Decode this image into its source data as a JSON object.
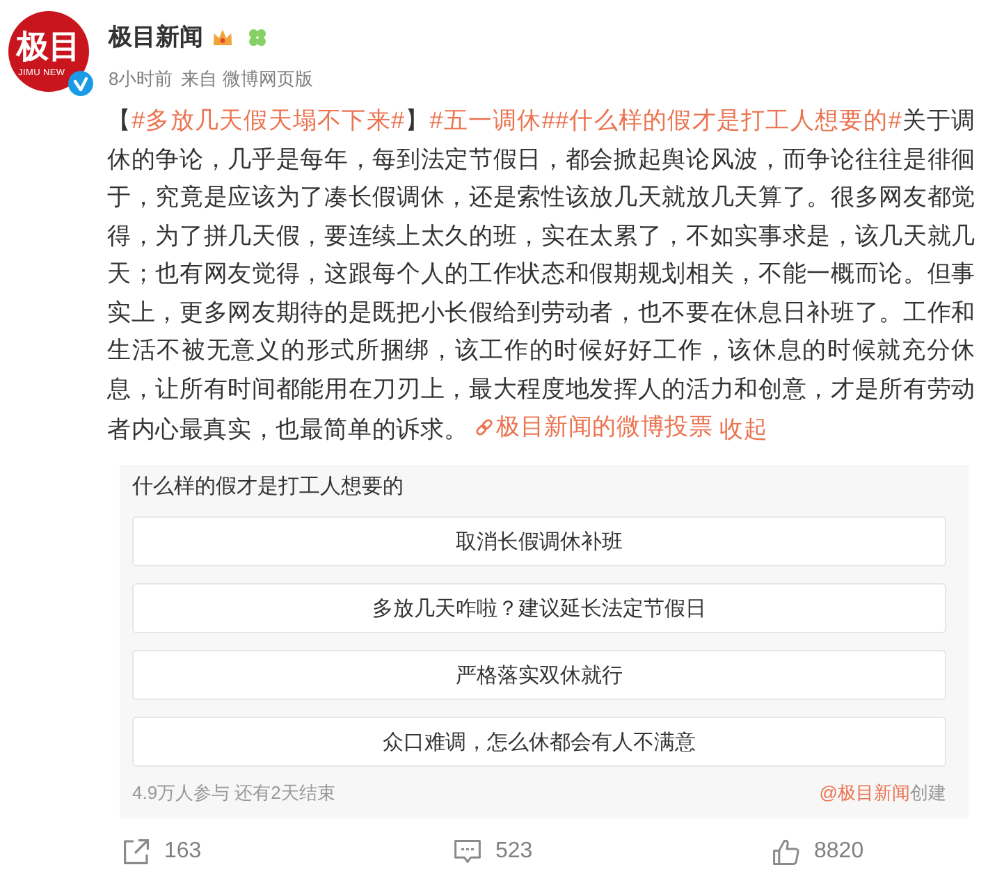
{
  "author": {
    "avatar": {
      "logo_text": "极目",
      "logo_subtext": "JIMU NEW"
    },
    "name": "极目新闻",
    "verified": true,
    "badges": [
      {
        "kind": "crown"
      },
      {
        "kind": "clover"
      }
    ],
    "time": "8小时前",
    "source": "来自 微博网页版"
  },
  "post": {
    "segments": [
      {
        "kind": "text",
        "text": "【"
      },
      {
        "kind": "hashtag",
        "text": "#多放几天假天塌不下来#"
      },
      {
        "kind": "text",
        "text": "】"
      },
      {
        "kind": "hashtag",
        "text": "#五一调休#"
      },
      {
        "kind": "hashtag",
        "text": "#什么样的假才是打工人想要的#"
      },
      {
        "kind": "text",
        "text": "关于调休的争论，几乎是每年，每到法定节假日，都会掀起舆论风波，而争论往往是徘徊于，究竟是应该为了凑长假调休，还是索性该放几天就放几天算了。很多网友都觉得，为了拼几天假，要连续上太久的班，实在太累了，不如实事求是，该几天就几天；也有网友觉得，这跟每个人的工作状态和假期规划相关，不能一概而论。但事实上，更多网友期待的是既把小长假给到劳动者，也不要在休息日补班了。工作和生活不被无意义的形式所捆绑，该工作的时候好好工作，该休息的时候就充分休息，让所有时间都能用在刀刃上，最大程度地发挥人的活力和创意，才是所有劳动者内心最真实，也最简单的诉求。"
      },
      {
        "kind": "poll_link",
        "text": "极目新闻的微博投票"
      },
      {
        "kind": "collapse",
        "text": "收起"
      }
    ]
  },
  "poll": {
    "question": "什么样的假才是打工人想要的",
    "options": [
      {
        "label": "取消长假调休补班"
      },
      {
        "label": "多放几天咋啦？建议延长法定节假日"
      },
      {
        "label": "严格落实双休就行"
      },
      {
        "label": "众口难调，怎么休都会有人不满意"
      }
    ],
    "stats": "4.9万人参与 还有2天结束",
    "creator": "@极目新闻",
    "creator_suffix": "创建"
  },
  "actions": [
    {
      "kind": "repost",
      "count": "163"
    },
    {
      "kind": "comment",
      "count": "523"
    },
    {
      "kind": "like",
      "count": "8820"
    }
  ]
}
